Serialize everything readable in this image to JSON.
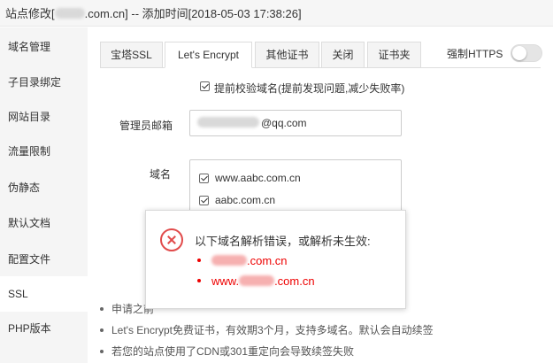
{
  "titlebar": {
    "prefix": "站点修改[",
    "suffix": ".com.cn] -- 添加时间[2018-05-03 17:38:26]"
  },
  "sidebar": {
    "items": [
      {
        "label": "域名管理"
      },
      {
        "label": "子目录绑定"
      },
      {
        "label": "网站目录"
      },
      {
        "label": "流量限制"
      },
      {
        "label": "伪静态"
      },
      {
        "label": "默认文档"
      },
      {
        "label": "配置文件"
      },
      {
        "label": "SSL"
      },
      {
        "label": "PHP版本"
      }
    ],
    "active_index": 7
  },
  "tabs": [
    {
      "label": "宝塔SSL"
    },
    {
      "label": "Let's Encrypt"
    },
    {
      "label": "其他证书"
    },
    {
      "label": "关闭"
    },
    {
      "label": "证书夹"
    }
  ],
  "force_https": {
    "label": "强制HTTPS",
    "enabled": false
  },
  "precheck": {
    "label": "提前校验域名(提前发现问题,减少失败率)",
    "checked": true
  },
  "email": {
    "label": "管理员邮箱",
    "value_suffix": "@qq.com"
  },
  "domains": {
    "label": "域名",
    "items": [
      {
        "name": "www.aabc.com.cn",
        "checked": true
      },
      {
        "name": "aabc.com.cn",
        "checked": true
      }
    ]
  },
  "tips": [
    "申请之前",
    "Let's Encrypt免费证书，有效期3个月，支持多域名。默认会自动续签",
    "若您的站点使用了CDN或301重定向会导致续签失败"
  ],
  "error_dialog": {
    "title": "以下域名解析错误，或解析未生效:",
    "items": [
      {
        "suffix": ".com.cn"
      },
      {
        "prefix": "www.",
        "suffix": ".com.cn"
      }
    ],
    "color": "#e00000"
  }
}
